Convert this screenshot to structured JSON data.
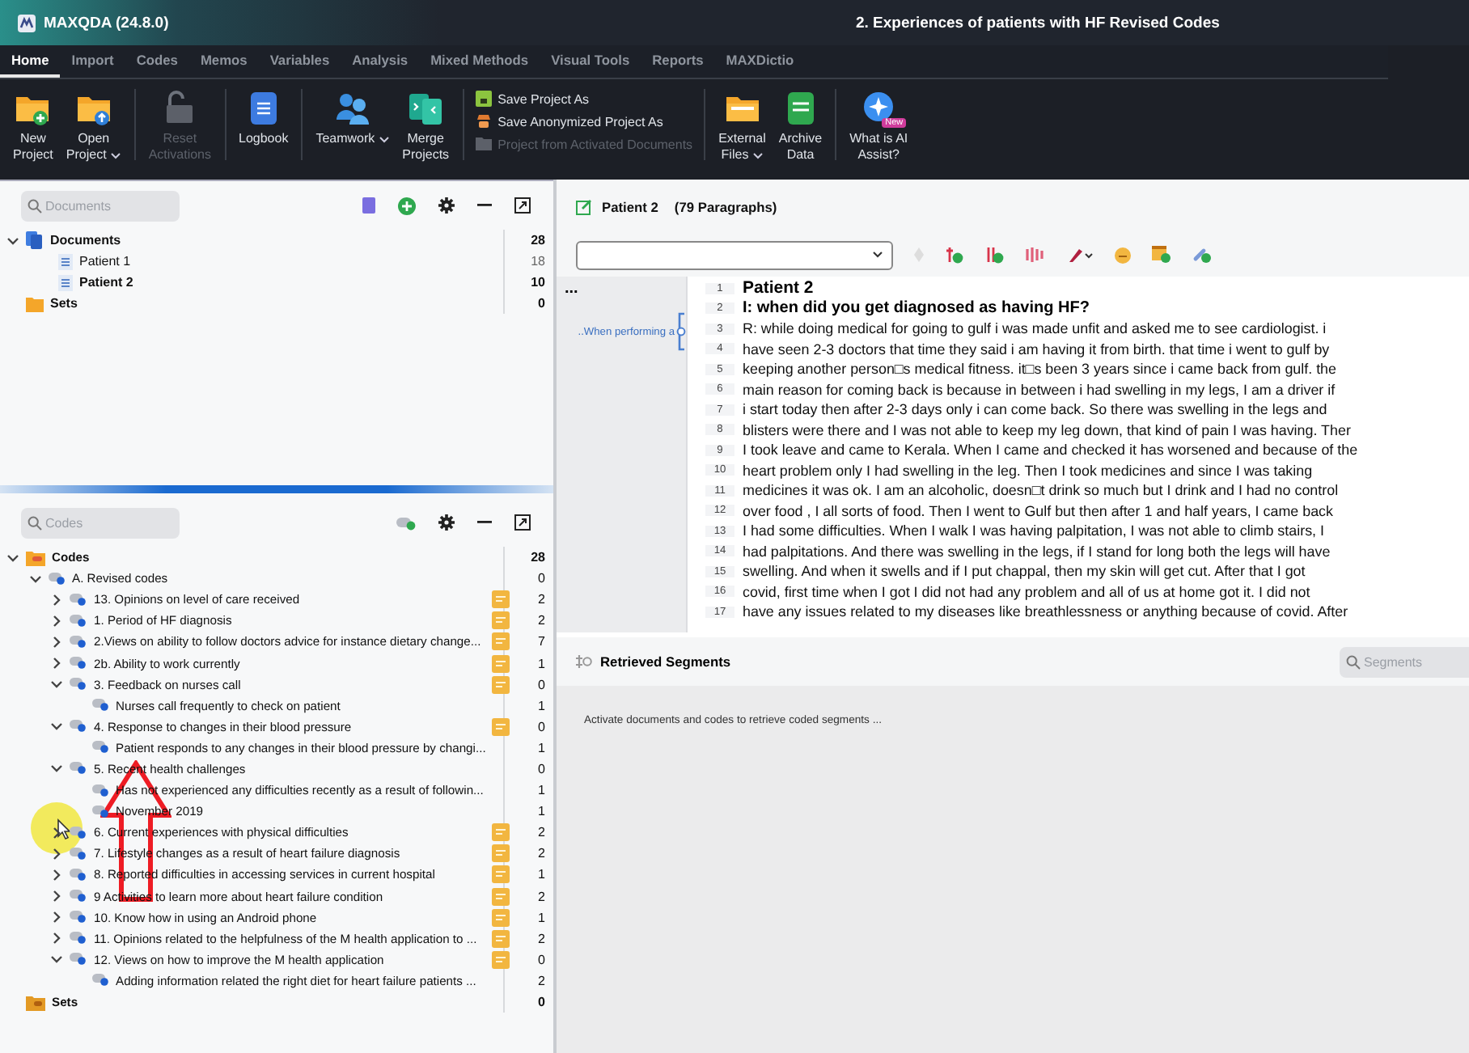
{
  "app": {
    "name": "MAXQDA (24.8.0)",
    "document_title": "2. Experiences of patients with HF Revised Codes"
  },
  "tabs": [
    {
      "label": "Home",
      "selected": true
    },
    {
      "label": "Import",
      "selected": false
    },
    {
      "label": "Codes",
      "selected": false
    },
    {
      "label": "Memos",
      "selected": false
    },
    {
      "label": "Variables",
      "selected": false
    },
    {
      "label": "Analysis",
      "selected": false
    },
    {
      "label": "Mixed Methods",
      "selected": false
    },
    {
      "label": "Visual Tools",
      "selected": false
    },
    {
      "label": "Reports",
      "selected": false
    },
    {
      "label": "MAXDictio",
      "selected": false
    }
  ],
  "ribbon": [
    {
      "kind": "large",
      "lines": [
        "New",
        "Project"
      ],
      "dropdown": false,
      "disabled": false
    },
    {
      "kind": "large",
      "lines": [
        "Open",
        "Project"
      ],
      "dropdown": true,
      "disabled": false
    },
    {
      "kind": "large",
      "lines": [
        "Reset",
        "Activations"
      ],
      "dropdown": false,
      "disabled": true
    },
    {
      "kind": "large",
      "lines": [
        "Logbook"
      ],
      "dropdown": false,
      "disabled": false
    },
    {
      "kind": "large",
      "lines": [
        "Teamwork"
      ],
      "dropdown": true,
      "disabled": false
    },
    {
      "kind": "large",
      "lines": [
        "Merge",
        "Projects"
      ],
      "dropdown": false,
      "disabled": false
    },
    {
      "kind": "stack",
      "items": [
        {
          "label": "Save Project As",
          "disabled": false
        },
        {
          "label": "Save Anonymized Project As",
          "disabled": false
        },
        {
          "label": "Project from Activated Documents",
          "disabled": true
        }
      ]
    },
    {
      "kind": "large",
      "lines": [
        "External",
        "Files"
      ],
      "dropdown": true,
      "disabled": false
    },
    {
      "kind": "large",
      "lines": [
        "Archive",
        "Data"
      ],
      "dropdown": false,
      "disabled": false
    },
    {
      "kind": "large",
      "lines": [
        "What is AI",
        "Assist?"
      ],
      "dropdown": false,
      "disabled": false,
      "badge": "New"
    }
  ],
  "documents": {
    "placeholder": "Documents",
    "tree": [
      {
        "kind": "folder",
        "label": "Documents",
        "count": "28",
        "expanded": true,
        "children": [
          {
            "kind": "document",
            "label": "Patient 1",
            "count": "18",
            "selected": false
          },
          {
            "kind": "document",
            "label": "Patient 2",
            "count": "10",
            "selected": true
          }
        ]
      },
      {
        "kind": "sets",
        "label": "Sets",
        "count": "0"
      }
    ]
  },
  "codes": {
    "placeholder": "Codes",
    "tree": [
      {
        "kind": "root",
        "label": "Codes",
        "count": "28",
        "expanded": true,
        "children": [
          {
            "kind": "code",
            "label": "A. Revised codes",
            "count": "0",
            "memo": false,
            "expanded": true,
            "children": [
              {
                "kind": "code",
                "label": "13. Opinions on level of care received",
                "count": "2",
                "memo": true,
                "expanded": false
              },
              {
                "kind": "code",
                "label": "1. Period of HF diagnosis",
                "count": "2",
                "memo": true,
                "expanded": false
              },
              {
                "kind": "code",
                "label": "2.Views on ability to follow doctors advice for instance dietary change...",
                "count": "7",
                "memo": true,
                "expanded": false
              },
              {
                "kind": "code",
                "label": "2b. Ability to work currently",
                "count": "1",
                "memo": true,
                "expanded": false
              },
              {
                "kind": "code",
                "label": "3. Feedback on nurses call",
                "count": "0",
                "memo": true,
                "expanded": true,
                "children": [
                  {
                    "kind": "code",
                    "label": "Nurses call frequently to check on patient",
                    "count": "1",
                    "memo": false
                  }
                ]
              },
              {
                "kind": "code",
                "label": "4. Response to changes in their blood pressure",
                "count": "0",
                "memo": true,
                "expanded": true,
                "children": [
                  {
                    "kind": "code",
                    "label": "Patient responds to any changes in their blood pressure by changi...",
                    "count": "1",
                    "memo": false
                  }
                ]
              },
              {
                "kind": "code",
                "label": "5.  Recent health challenges",
                "count": "0",
                "memo": false,
                "expanded": true,
                "children": [
                  {
                    "kind": "code",
                    "label": "Has not experienced any difficulties recently as a result of followin...",
                    "count": "1",
                    "memo": false
                  },
                  {
                    "kind": "code",
                    "label": "November 2019",
                    "count": "1",
                    "memo": false
                  }
                ]
              },
              {
                "kind": "code",
                "label": "6. Current experiences with physical difficulties",
                "count": "2",
                "memo": true,
                "expanded": false
              },
              {
                "kind": "code",
                "label": "7. Lifestyle changes as a result of heart failure diagnosis",
                "count": "2",
                "memo": true,
                "expanded": false
              },
              {
                "kind": "code",
                "label": "8. Reported difficulties in accessing services in current hospital",
                "count": "1",
                "memo": true,
                "expanded": false
              },
              {
                "kind": "code",
                "label": "9 Activities to learn more about heart failure condition",
                "count": "2",
                "memo": true,
                "expanded": false
              },
              {
                "kind": "code",
                "label": "10. Know how in using an Android phone",
                "count": "1",
                "memo": true,
                "expanded": false
              },
              {
                "kind": "code",
                "label": "11. Opinions related to the helpfulness of the M health application to ...",
                "count": "2",
                "memo": true,
                "expanded": false
              },
              {
                "kind": "code",
                "label": "12. Views on how to improve the M health application",
                "count": "0",
                "memo": true,
                "expanded": true,
                "children": [
                  {
                    "kind": "code",
                    "label": "Adding information related the right diet for heart failure patients ...",
                    "count": "2",
                    "memo": false
                  }
                ]
              }
            ]
          }
        ]
      },
      {
        "kind": "sets",
        "label": "Sets",
        "count": "0"
      }
    ]
  },
  "viewer": {
    "title": "Patient 2",
    "paragraphs": "(79 Paragraphs)",
    "more": "...",
    "memo": "..When performing a",
    "lines": [
      {
        "num": "1",
        "kind": "title",
        "text": "Patient 2"
      },
      {
        "num": "2",
        "kind": "heading",
        "text": "I: when did you get diagnosed as having HF?"
      },
      {
        "num": "3",
        "kind": "text",
        "text": "R: while doing medical for going to gulf i was made unfit and asked me to see cardiologist. i"
      },
      {
        "num": "4",
        "kind": "text",
        "text": "have seen 2-3 doctors that time they said i am having it from birth. that time i went to gulf by"
      },
      {
        "num": "5",
        "kind": "text",
        "text": "keeping another person□s medical fitness. it□s been 3 years since i came back from gulf. the"
      },
      {
        "num": "6",
        "kind": "text",
        "text": "main reason for coming back is because in between i had swelling in my legs, I am a driver if"
      },
      {
        "num": "7",
        "kind": "text",
        "text": "i start today then after 2-3 days only i can come back. So there was swelling in the legs and"
      },
      {
        "num": "8",
        "kind": "text",
        "text": "blisters were there and I was not able to keep my leg down, that kind of pain I was having. Ther"
      },
      {
        "num": "9",
        "kind": "text",
        "text": "I took leave and came to Kerala. When I came and checked it has worsened and because of the"
      },
      {
        "num": "10",
        "kind": "text",
        "text": "heart problem only I had swelling in the leg. Then I took medicines and since I was taking"
      },
      {
        "num": "11",
        "kind": "text",
        "text": "medicines it was ok. I am an alcoholic, doesn□t drink so much but I drink and I had no control"
      },
      {
        "num": "12",
        "kind": "text",
        "text": "over food , I all sorts of food. Then I went to Gulf but then after 1 and half years, I came back"
      },
      {
        "num": "13",
        "kind": "text",
        "text": "I had some difficulties. When I walk I was having palpitation, I was not able to climb stairs, I"
      },
      {
        "num": "14",
        "kind": "text",
        "text": "had palpitations. And there was swelling in the legs, if I stand for long both the legs will have"
      },
      {
        "num": "15",
        "kind": "text",
        "text": "swelling. And when it swells and if I put chappal, then my skin will get cut. After that I got"
      },
      {
        "num": "16",
        "kind": "text",
        "text": "covid, first time when I got I did not had any problem and all of us at home got it. I did not"
      },
      {
        "num": "17",
        "kind": "text",
        "text": "have any issues related to my diseases like breathlessness or anything because of covid. After"
      }
    ]
  },
  "retrieved": {
    "title": "Retrieved Segments",
    "placeholder": "Segments",
    "message": "Activate documents and codes to retrieve coded segments ..."
  }
}
